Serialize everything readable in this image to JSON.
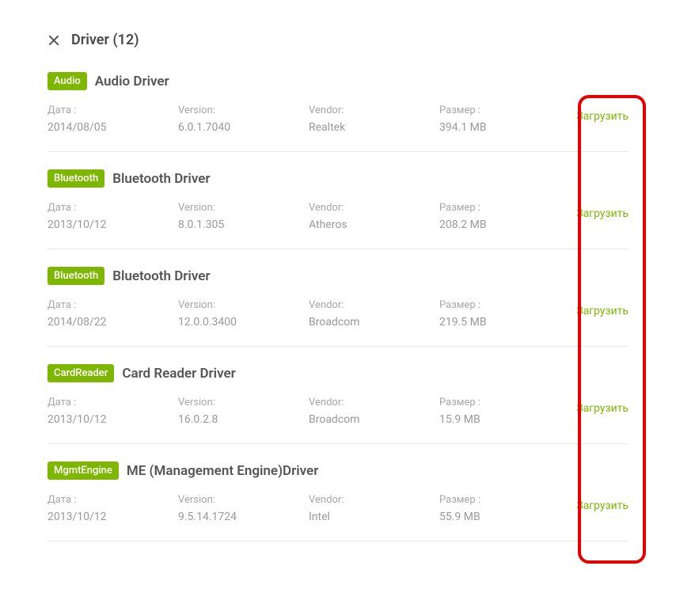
{
  "header": {
    "title": "Driver (12)"
  },
  "labels": {
    "date": "Дата :",
    "version": "Version:",
    "vendor": "Vendor:",
    "size": "Размер :",
    "download": "Загрузить"
  },
  "drivers": [
    {
      "badge": "Audio",
      "name": "Audio Driver",
      "date": "2014/08/05",
      "version": "6.0.1.7040",
      "vendor": "Realtek",
      "size": "394.1 MB"
    },
    {
      "badge": "Bluetooth",
      "name": "Bluetooth Driver",
      "date": "2013/10/12",
      "version": "8.0.1.305",
      "vendor": "Atheros",
      "size": "208.2 MB"
    },
    {
      "badge": "Bluetooth",
      "name": "Bluetooth Driver",
      "date": "2014/08/22",
      "version": "12.0.0.3400",
      "vendor": "Broadcom",
      "size": "219.5 MB"
    },
    {
      "badge": "CardReader",
      "name": "Card Reader Driver",
      "date": "2013/10/12",
      "version": "16.0.2.8",
      "vendor": "Broadcom",
      "size": "15.9 MB"
    },
    {
      "badge": "MgmtEngine",
      "name": "ME (Management Engine)Driver",
      "date": "2013/10/12",
      "version": "9.5.14.1724",
      "vendor": "Intel",
      "size": "55.9 MB"
    }
  ]
}
